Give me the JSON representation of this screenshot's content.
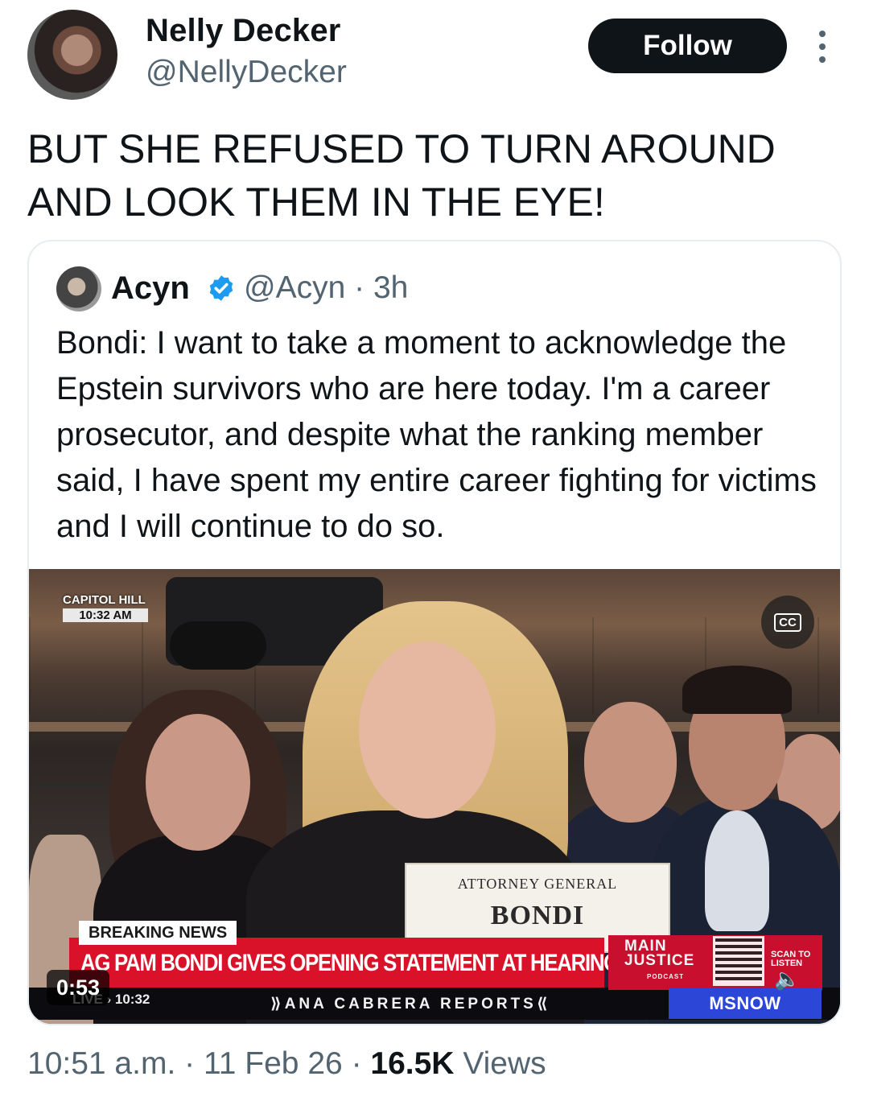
{
  "post": {
    "author_name": "Nelly Decker",
    "author_handle": "@NellyDecker",
    "follow_label": "Follow",
    "text": "BUT SHE REFUSED TO TURN AROUND AND LOOK THEM IN THE EYE!",
    "time": "10:51 a.m.",
    "date": "11 Feb 26",
    "separator": "·",
    "views_count": "16.5K",
    "views_label": "Views"
  },
  "quoted": {
    "author_name": "Acyn",
    "verified": true,
    "author_handle": "@Acyn · 3h",
    "text": "Bondi: I want to take a moment to acknowledge the Epstein survivors who are here today. I'm a career prosecutor, and despite what the ranking member said, I have spent my entire career fighting for victims and I will continue to do so.",
    "video": {
      "duration": "0:53",
      "cc_label": "CC",
      "location": "CAPITOL HILL",
      "clock": "10:32 AM",
      "nameplate_title": "ATTORNEY GENERAL",
      "nameplate_name": "BONDI",
      "breaking_label": "BREAKING NEWS",
      "headline": "AG PAM BONDI GIVES OPENING STATEMENT AT HEARING",
      "live_label": "LIVE › 10:32",
      "reporter": "⟫ANA CABRERA REPORTS⟪",
      "promo_line1": "MAIN",
      "promo_line2": "JUSTICE",
      "promo_sub": "PODCAST",
      "scan_label": "SCAN TO LISTEN",
      "network": "MSNOW"
    }
  },
  "colors": {
    "text_primary": "#0f1419",
    "text_secondary": "#536471",
    "follow_bg": "#0f1419",
    "verified_blue": "#1d9bf0",
    "news_red": "#d9122a",
    "network_blue": "#2c46d8"
  },
  "icons": {
    "more": "more-vertical-icon",
    "verified": "verified-badge-icon",
    "cc": "closed-captions-icon",
    "speaker": "speaker-icon"
  }
}
